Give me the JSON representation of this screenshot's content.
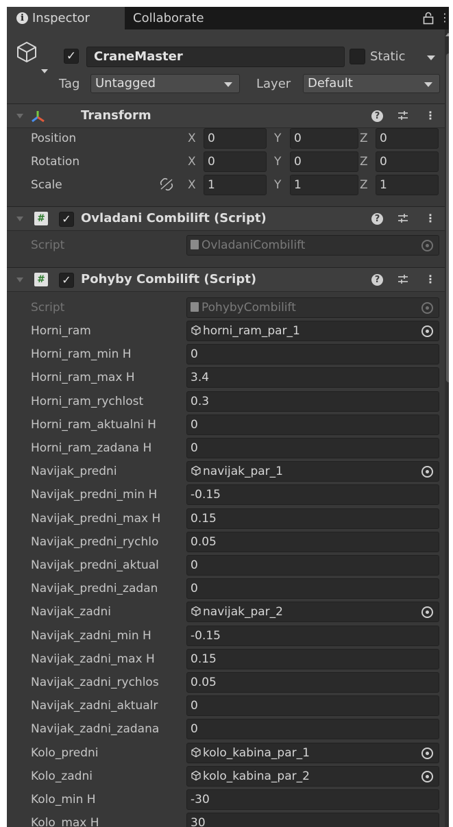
{
  "tabs": [
    {
      "label": "Inspector",
      "icon": "info-icon"
    },
    {
      "label": "Collaborate"
    }
  ],
  "gameobject": {
    "active": true,
    "name": "CraneMaster",
    "static_label": "Static",
    "static": false,
    "tag_label": "Tag",
    "tag_value": "Untagged",
    "layer_label": "Layer",
    "layer_value": "Default"
  },
  "transform": {
    "title": "Transform",
    "position": {
      "label": "Position",
      "x": "0",
      "y": "0",
      "z": "0"
    },
    "rotation": {
      "label": "Rotation",
      "x": "0",
      "y": "0",
      "z": "0"
    },
    "scale": {
      "label": "Scale",
      "x": "1",
      "y": "1",
      "z": "1"
    },
    "axes": {
      "x": "X",
      "y": "Y",
      "z": "Z"
    }
  },
  "ovladani": {
    "title": "Ovladani Combilift (Script)",
    "script_label": "Script",
    "script_value": "OvladaniCombilift"
  },
  "pohyby": {
    "title": "Pohyby Combilift (Script)",
    "script_label": "Script",
    "script_value": "PohybyCombilift",
    "rows": [
      {
        "label": "Horni_ram",
        "value": "horni_ram_par_1",
        "type": "object"
      },
      {
        "label": "Horni_ram_min H",
        "value": "0",
        "type": "number"
      },
      {
        "label": "Horni_ram_max H",
        "value": "3.4",
        "type": "number"
      },
      {
        "label": "Horni_ram_rychlost",
        "value": "0.3",
        "type": "number"
      },
      {
        "label": "Horni_ram_aktualni H",
        "value": "0",
        "type": "number"
      },
      {
        "label": "Horni_ram_zadana H",
        "value": "0",
        "type": "number"
      },
      {
        "label": "Navijak_predni",
        "value": "navijak_par_1",
        "type": "object"
      },
      {
        "label": "Navijak_predni_min H",
        "value": "-0.15",
        "type": "number"
      },
      {
        "label": "Navijak_predni_max H",
        "value": "0.15",
        "type": "number"
      },
      {
        "label": "Navijak_predni_rychlo",
        "value": "0.05",
        "type": "number"
      },
      {
        "label": "Navijak_predni_aktual",
        "value": "0",
        "type": "number"
      },
      {
        "label": "Navijak_predni_zadan",
        "value": "0",
        "type": "number"
      },
      {
        "label": "Navijak_zadni",
        "value": "navijak_par_2",
        "type": "object"
      },
      {
        "label": "Navijak_zadni_min H",
        "value": "-0.15",
        "type": "number"
      },
      {
        "label": "Navijak_zadni_max H",
        "value": "0.15",
        "type": "number"
      },
      {
        "label": "Navijak_zadni_rychlos",
        "value": "0.05",
        "type": "number"
      },
      {
        "label": "Navijak_zadni_aktualr",
        "value": "0",
        "type": "number"
      },
      {
        "label": "Navijak_zadni_zadana",
        "value": "0",
        "type": "number"
      },
      {
        "label": "Kolo_predni",
        "value": "kolo_kabina_par_1",
        "type": "object"
      },
      {
        "label": "Kolo_zadni",
        "value": "kolo_kabina_par_2",
        "type": "object"
      },
      {
        "label": "Kolo_min H",
        "value": "-30",
        "type": "number"
      },
      {
        "label": "Kolo_max H",
        "value": "30",
        "type": "number"
      }
    ]
  },
  "colors": {
    "panel_bg": "#383838",
    "header_bg": "#3e3e3e",
    "field_bg": "#2a2a2a",
    "tab_bar_bg": "#191919",
    "transform_icon": [
      "#e05a3a",
      "#7ac943",
      "#4a8ef0"
    ],
    "script_icon_hash": "#2c7a2c"
  }
}
